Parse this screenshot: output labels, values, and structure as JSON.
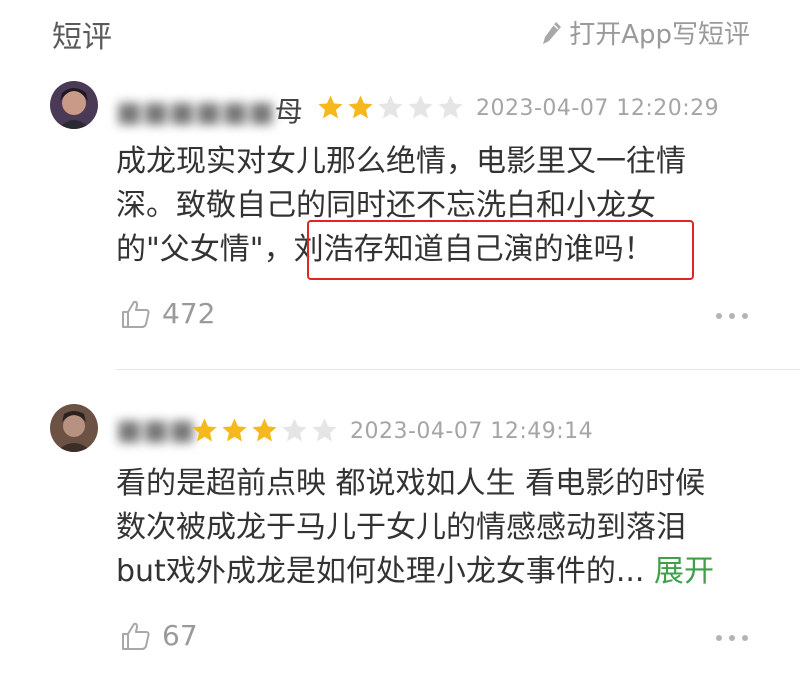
{
  "header": {
    "title": "短评",
    "write_link": "打开App写短评",
    "icon": "pencil-icon"
  },
  "reviews": [
    {
      "username": "■■■■■■母",
      "rating": 2,
      "max_rating": 5,
      "date": "2023-04-07 12:20:29",
      "lines": [
        "成龙现实对女儿那么绝情，电影里又一往情",
        "深。致敬自己的同时还不忘洗白和小龙女",
        "的\"父女情\"，",
        "刘浩存知道自己演的谁吗！"
      ],
      "likes": "472"
    },
    {
      "username": "■■■",
      "rating": 3,
      "max_rating": 5,
      "date": "2023-04-07 12:49:14",
      "lines": [
        "看的是超前点映 都说戏如人生 看电影的时候",
        "数次被成龙于马儿于女儿的情感感动到落泪",
        "but戏外成龙是如何处理小龙女事件的..."
      ],
      "expand_label": "展开",
      "likes": "67"
    }
  ],
  "colors": {
    "star_filled": "#f5b91e",
    "star_empty": "#e5e5e5",
    "highlight_border": "#e02525",
    "expand_link": "#3ea14a"
  }
}
